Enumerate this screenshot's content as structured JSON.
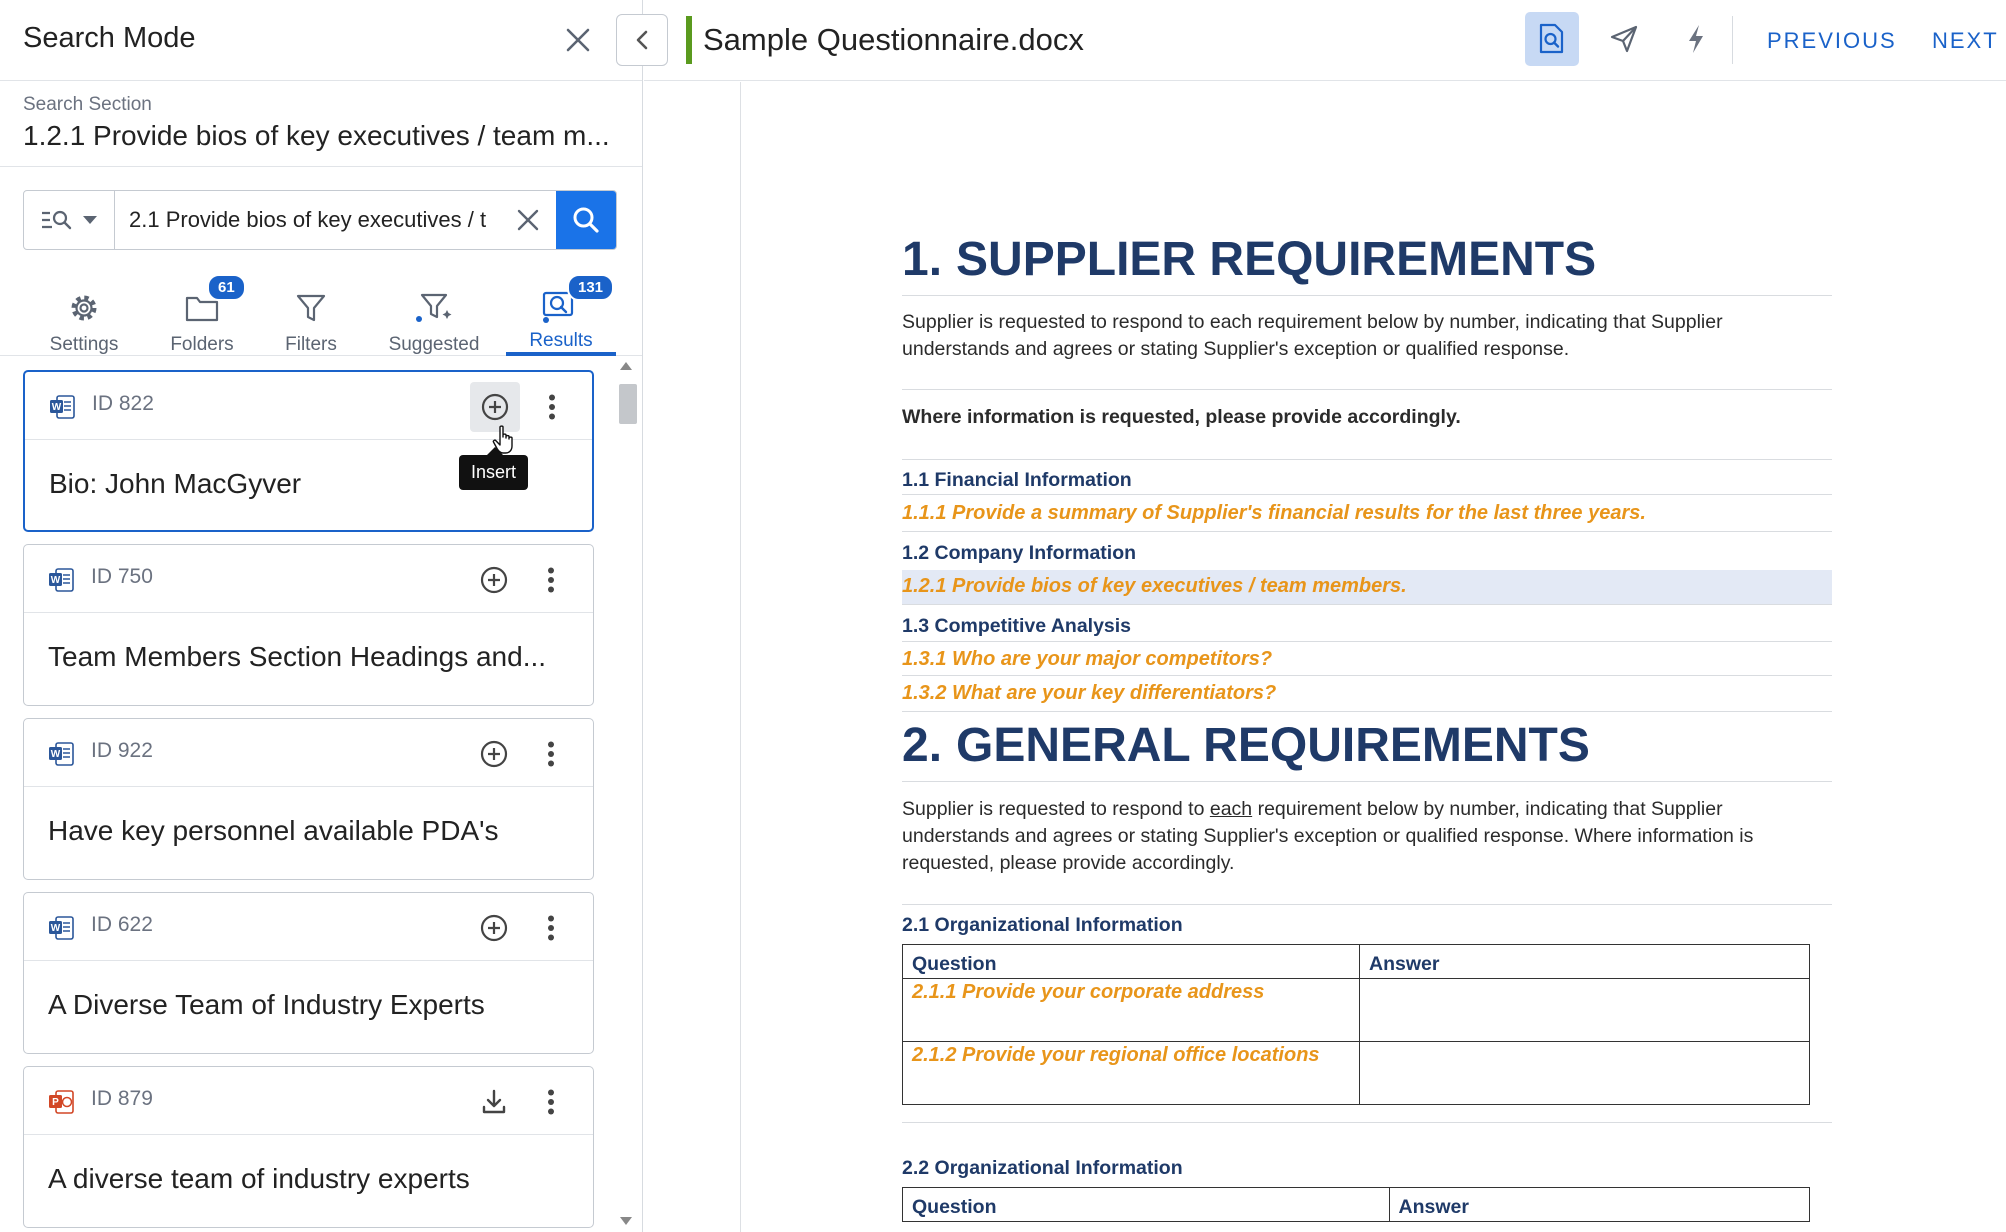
{
  "panel": {
    "title": "Search Mode",
    "search_section_label": "Search Section",
    "search_section_value": "1.2.1 Provide bios of key executives / team m...",
    "search_value": "2.1 Provide bios of key executives / t"
  },
  "tabs": [
    {
      "label": "Settings",
      "icon": "gear-icon"
    },
    {
      "label": "Folders",
      "icon": "folder-icon",
      "badge": "61"
    },
    {
      "label": "Filters",
      "icon": "filter-icon"
    },
    {
      "label": "Suggested",
      "icon": "suggested-filter-icon"
    },
    {
      "label": "Results",
      "icon": "results-search-icon",
      "badge": "131",
      "active": true
    }
  ],
  "results": [
    {
      "id": "ID 822",
      "title": "Bio: John MacGyver",
      "file_type": "word",
      "action": "insert"
    },
    {
      "id": "ID 750",
      "title": "Team Members Section Headings and...",
      "file_type": "word",
      "action": "insert"
    },
    {
      "id": "ID 922",
      "title": "Have key personnel available PDA's",
      "file_type": "word",
      "action": "insert"
    },
    {
      "id": "ID 622",
      "title": "A Diverse Team of Industry Experts",
      "file_type": "word",
      "action": "insert"
    },
    {
      "id": "ID 879",
      "title": "A diverse team of industry experts",
      "file_type": "powerpoint",
      "action": "download"
    }
  ],
  "tooltip": "Insert",
  "viewer": {
    "doc_title": "Sample Questionnaire.docx",
    "previous": "PREVIOUS",
    "next": "NEXT"
  },
  "document": {
    "s1_num": "1.",
    "s1_title": "SUPPLIER REQUIREMENTS",
    "s1_para": "Supplier is requested to respond to each requirement below by number, indicating that Supplier understands and agrees or stating Supplier's exception or qualified response.",
    "s1_bold": "Where information is requested, please provide accordingly.",
    "h11": "1.1 Financial Information",
    "q111": "1.1.1 Provide a summary of Supplier's financial results for the last three years.",
    "h12": "1.2 Company Information",
    "q121": "1.2.1 Provide bios of key executives / team members.",
    "h13": "1.3 Competitive Analysis",
    "q131": "1.3.1 Who are your major competitors?",
    "q132": "1.3.2 What are your key differentiators?",
    "s2_num": "2.",
    "s2_title": "GENERAL REQUIREMENTS",
    "s2_para_a": "Supplier is requested to respond to ",
    "s2_para_each": "each",
    "s2_para_b": " requirement below by number, indicating that Supplier understands and agrees or stating Supplier's exception or qualified response.  Where information is requested, please provide accordingly.",
    "h21": "2.1 Organizational Information",
    "t1_q_header": "Question",
    "t1_a_header": "Answer",
    "q211": "2.1.1 Provide your corporate address",
    "q212": "2.1.2 Provide your regional office locations",
    "h22": "2.2 Organizational Information",
    "t2_q_header": "Question",
    "t2_a_header": "Answer"
  },
  "colors": {
    "accent_blue": "#1a62c9",
    "heading_navy": "#1f3a68",
    "question_orange": "#e8951a",
    "doc_accent_green": "#5a9a1e",
    "word_blue": "#2b579a",
    "ppt_red": "#d24726"
  }
}
